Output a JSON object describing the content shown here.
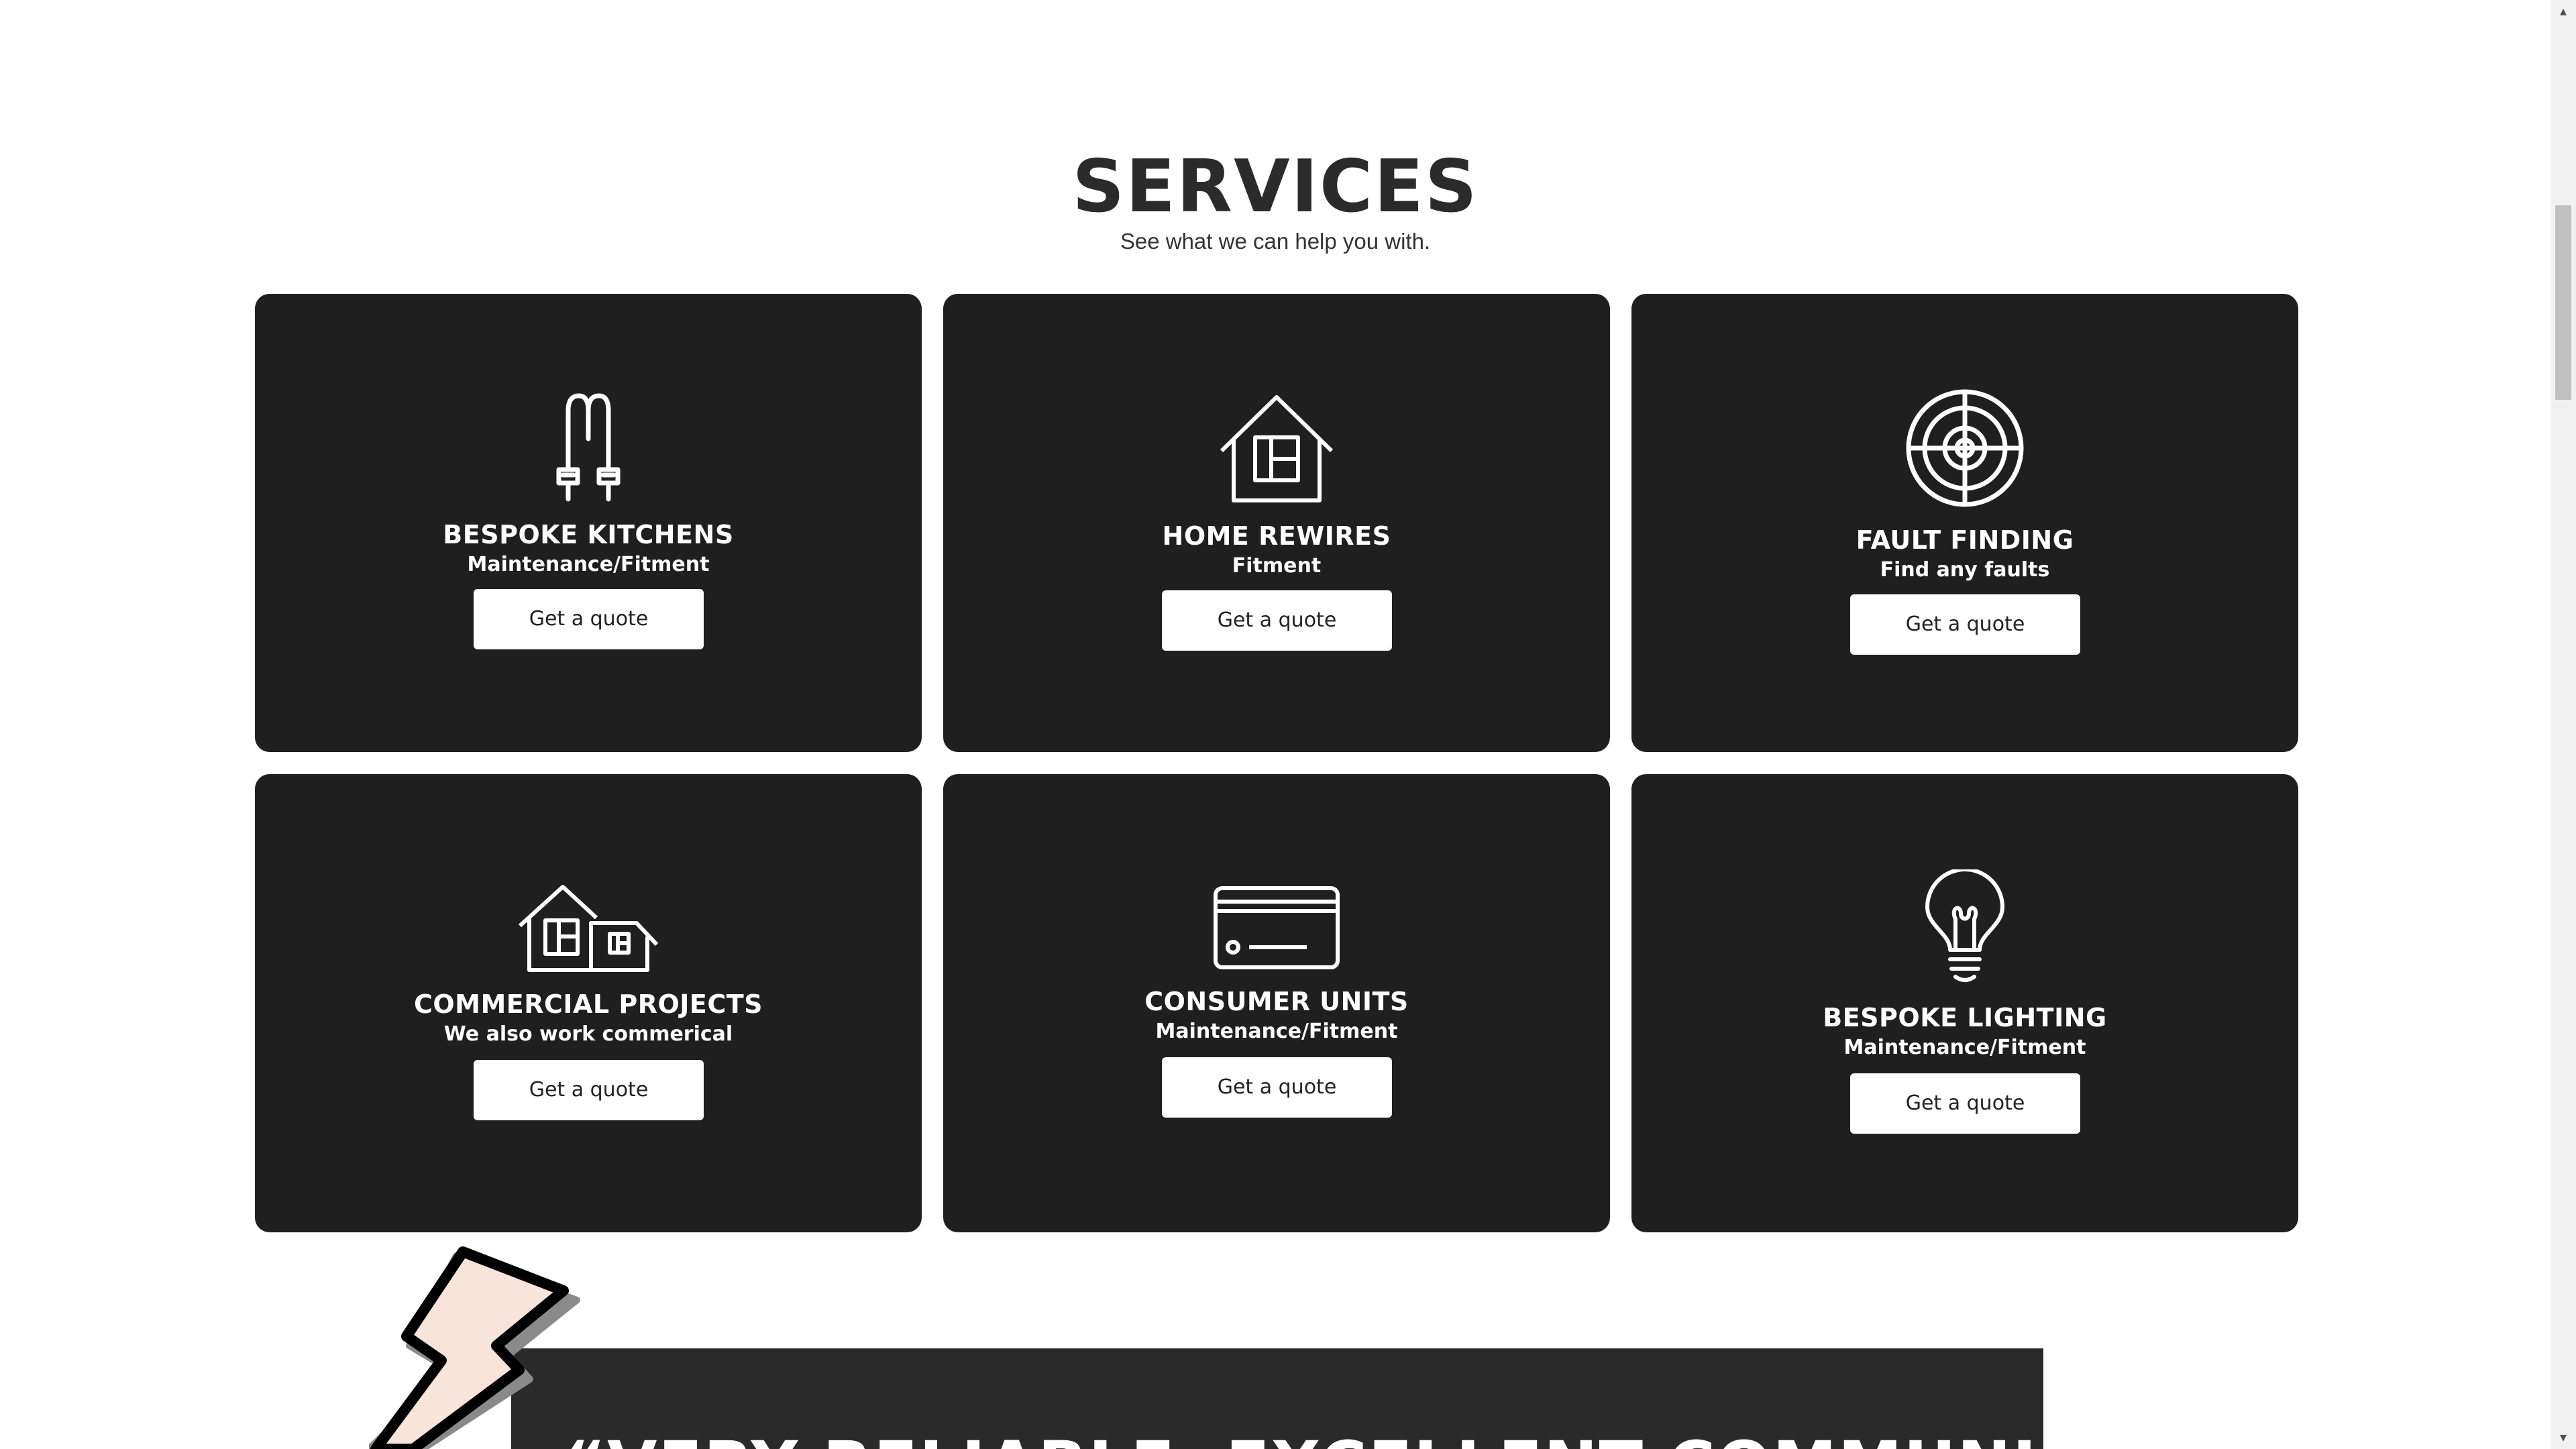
{
  "section": {
    "title": "SERVICES",
    "subtitle": "See what we can help you with."
  },
  "cards": [
    {
      "title": "BESPOKE KITCHENS",
      "subtitle": "Maintenance/Fitment",
      "button": "Get a quote",
      "icon": "cable-icon"
    },
    {
      "title": "HOME REWIRES",
      "subtitle": "Fitment",
      "button": "Get a quote",
      "icon": "house-icon"
    },
    {
      "title": "FAULT FINDING",
      "subtitle": "Find any faults",
      "button": "Get a quote",
      "icon": "target-icon"
    },
    {
      "title": "COMMERCIAL PROJECTS",
      "subtitle": "We also work commerical",
      "button": "Get a quote",
      "icon": "buildings-icon"
    },
    {
      "title": "CONSUMER UNITS",
      "subtitle": "Maintenance/Fitment",
      "button": "Get a quote",
      "icon": "consumer-unit-icon"
    },
    {
      "title": "BESPOKE LIGHTING",
      "subtitle": "Maintenance/Fitment",
      "button": "Get a quote",
      "icon": "lightbulb-icon"
    }
  ],
  "testimonial": {
    "text": "“VERY RELIABLE, EXCELLENT COMMUNICATION"
  },
  "colors": {
    "card_background": "#1f1f1f",
    "heading": "#2b2b2b",
    "button_background": "#ffffff",
    "bolt_fill": "#f9e4da"
  }
}
